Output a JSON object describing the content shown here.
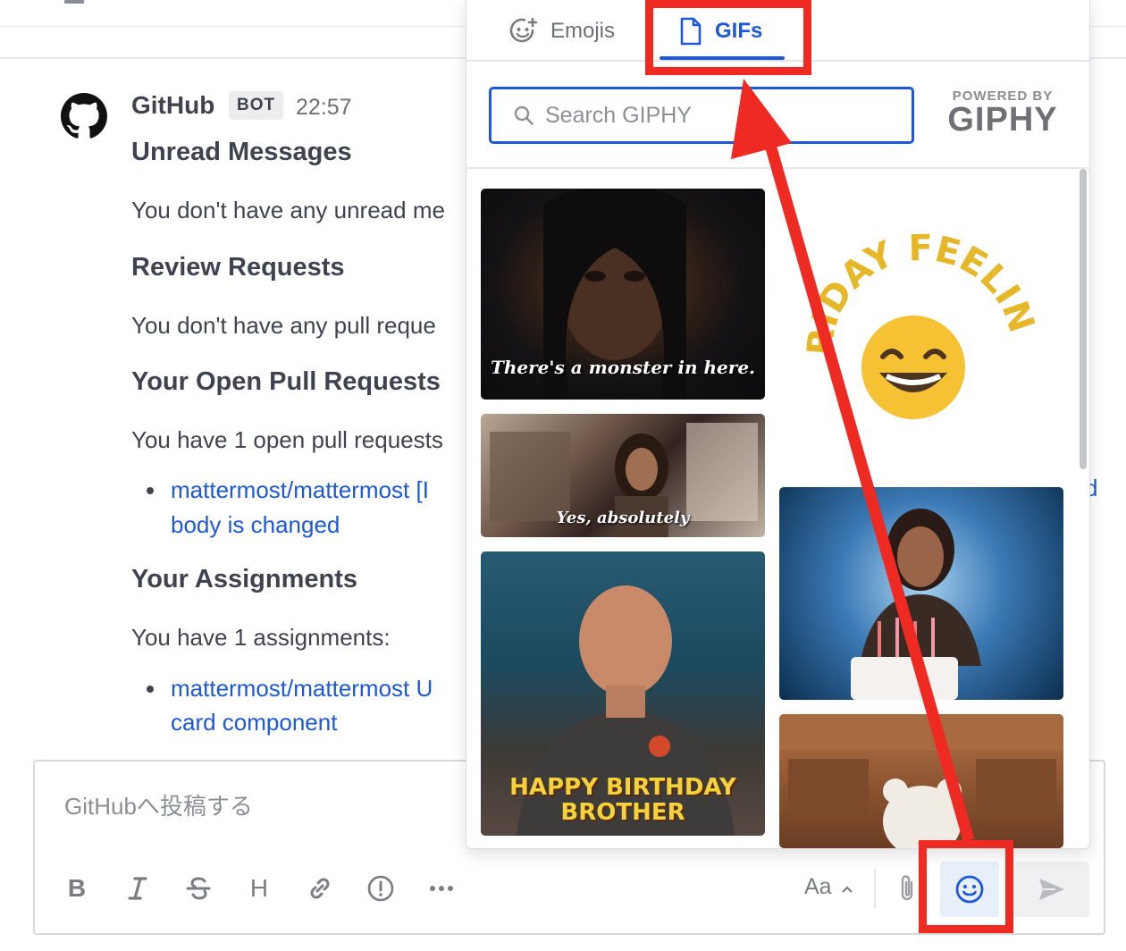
{
  "post": {
    "author": "GitHub",
    "badge": "BOT",
    "time": "22:57",
    "sections": {
      "unread_title": "Unread Messages",
      "unread_text": "You don't have any unread me",
      "review_title": "Review Requests",
      "review_text": "You don't have any pull reque",
      "open_title": "Your Open Pull Requests",
      "open_text": "You have 1 open pull requests",
      "open_link_line1": "mattermost/mattermost [I",
      "open_link_line2": "body is changed",
      "open_link_fragment": "d",
      "assign_title": "Your Assignments",
      "assign_text": "You have 1 assignments:",
      "assign_link_line1": "mattermost/mattermost U",
      "assign_link_line2": "card component"
    }
  },
  "composer": {
    "placeholder": "GitHubへ投稿する",
    "aa_label": "Aa",
    "toolbar": {
      "bold": "B",
      "heading": "H"
    }
  },
  "picker": {
    "tabs": {
      "emojis": "Emojis",
      "gifs": "GIFs"
    },
    "active_tab": "GIFs",
    "search_placeholder": "Search GIPHY",
    "powered_small": "POWERED BY",
    "powered_big": "GIPHY",
    "gifs": [
      {
        "caption": "There's a monster in here."
      },
      {
        "caption": "Yes, absolutely"
      },
      {
        "caption_line1": "HAPPY BIRTHDAY",
        "caption_line2": "BROTHER"
      },
      {
        "caption": "FRIDAY FEELING!"
      }
    ]
  },
  "colors": {
    "accent": "#1c58d9",
    "annotation": "#ee2a22",
    "text": "#3f4350",
    "muted": "#8d8f96"
  }
}
